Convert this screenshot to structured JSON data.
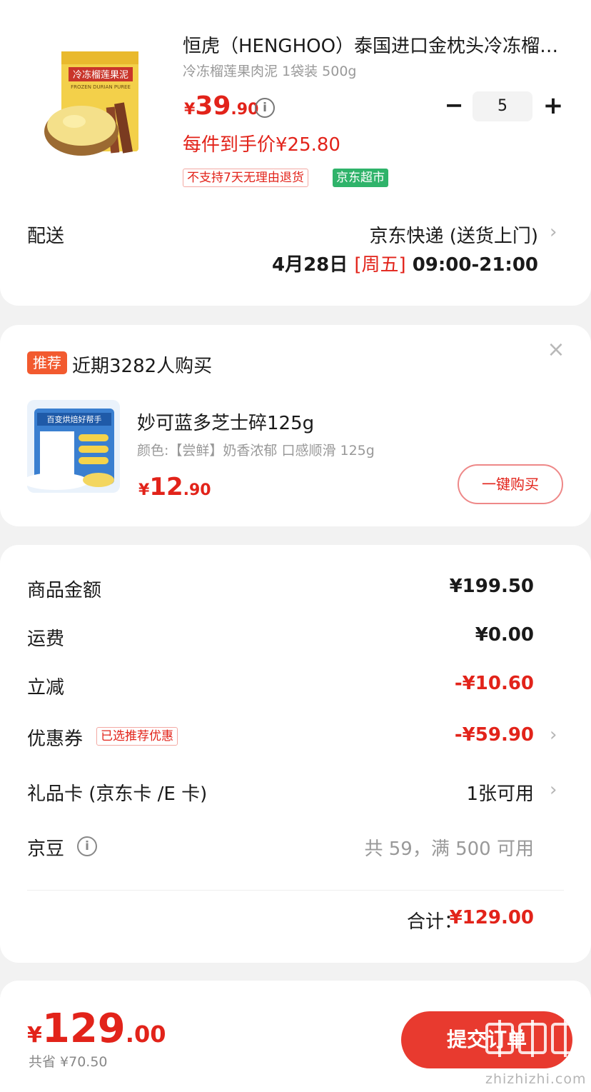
{
  "product": {
    "title": "恒虎（HENGHOO）泰国进口金枕头冷冻榴莲果肉泥",
    "spec": "冷冻榴莲果肉泥 1袋装 500g",
    "image_text": "冷冻榴莲果泥",
    "image_text_en": "FROZEN DURIAN PUREE",
    "price_symbol": "¥",
    "price_int": "39",
    "price_dec": ".90",
    "quantity": "5",
    "minus": "−",
    "plus": "+",
    "deal_price": "每件到手价¥25.80",
    "tag_no_return": "不支持7天无理由退货",
    "tag_store": "京东超市"
  },
  "delivery": {
    "label": "配送",
    "method": "京东快递 (送货上门)",
    "date": "4月28日",
    "weekday": "[周五]",
    "time": "09:00-21:00"
  },
  "recommend": {
    "badge": "推荐",
    "text": "近期3282人购买",
    "close": "×",
    "image_text": "百变烘焙好帮手",
    "name": "妙可蓝多芝士碎125g",
    "spec": "颜色:【尝鲜】奶香浓郁 口感顺滑 125g",
    "price_symbol": "¥",
    "price_int": "12",
    "price_dec": ".90",
    "buy_label": "一键购买"
  },
  "summary": {
    "goods_label": "商品金额",
    "goods_value": "¥199.50",
    "shipping_label": "运费",
    "shipping_value": "¥0.00",
    "discount_label": "立减",
    "discount_value": "-¥10.60",
    "coupon_label": "优惠券",
    "coupon_tag": "已选推荐优惠",
    "coupon_value": "-¥59.90",
    "giftcard_label": "礼品卡 (京东卡 /E 卡)",
    "giftcard_value": "1张可用",
    "beans_label": "京豆",
    "beans_value": "共 59，满 500 可用",
    "total_label": "合计：",
    "total_value": "¥129.00"
  },
  "bottom": {
    "price_symbol": "¥",
    "price_int": "129",
    "price_dec": ".00",
    "saved": "共省 ¥70.50",
    "submit_label": "提交订单",
    "watermark_text": "zhizhizhi.com"
  },
  "colors": {
    "accent_red": "#e2231a",
    "tag_green": "#2fb36a",
    "badge_orange": "#f25a2f",
    "submit_red": "#e83a2f"
  }
}
